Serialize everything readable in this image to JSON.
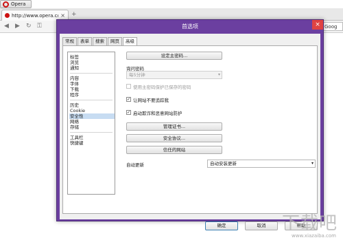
{
  "browser": {
    "menu_label": "Opera",
    "tab": {
      "title": "http://www.opera.co...",
      "close": "×"
    },
    "new_tab": "+",
    "address_right": "Goog"
  },
  "dialog": {
    "title": "首选项",
    "close": "×",
    "tabs": [
      "常规",
      "表单",
      "搜索",
      "网页",
      "高级"
    ],
    "categories": [
      "标签",
      "浏览",
      "通知",
      "内容",
      "字体",
      "下载",
      "程序",
      "历史",
      "Cookie",
      "安全性",
      "网络",
      "存储",
      "工具栏",
      "快捷键"
    ],
    "selected_category": "安全性",
    "security": {
      "set_master_password": "设定主密码...",
      "ask_password_label": "询问密码",
      "ask_password_value": "每5分钟",
      "use_master_password": "使用主密码保护已保存的密码",
      "do_not_track": "让网站不要追踪我",
      "fraud_protection": "启动欺诈和恶意网站防护",
      "manage_certs": "管理证书...",
      "security_protocols": "安全协议...",
      "trusted_sites": "信任的网站",
      "auto_update_label": "自动更新",
      "auto_update_value": "自动安装更新"
    },
    "footer": {
      "ok": "确定",
      "cancel": "取消",
      "help": "帮助"
    }
  },
  "watermark": {
    "text": "下载吧",
    "url": "www.xiazaiba.com"
  }
}
